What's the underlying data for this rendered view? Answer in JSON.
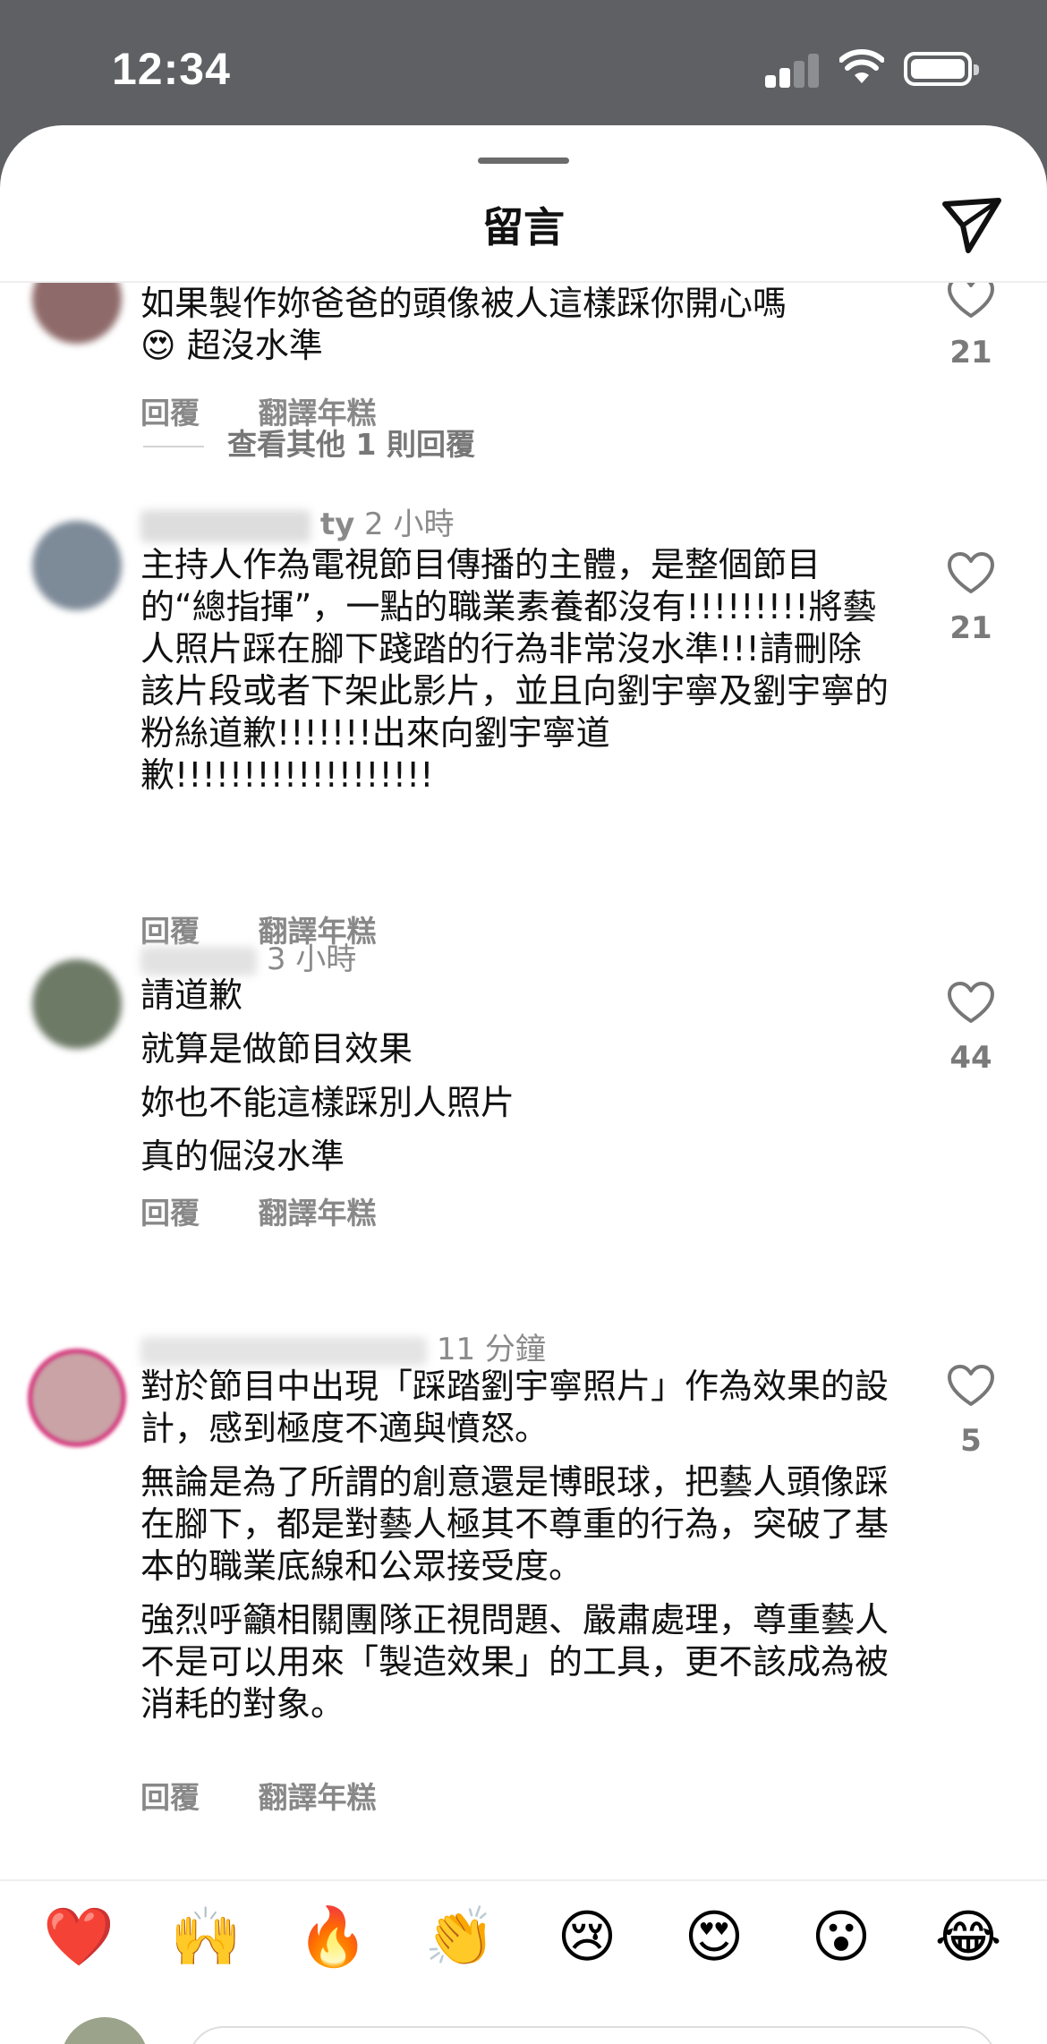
{
  "status_bar": {
    "time": "12:34"
  },
  "sheet": {
    "title": "留言"
  },
  "comments": [
    {
      "user": "",
      "time": "",
      "paragraphs": [
        "如果製作妳爸爸的頭像被人這樣踩你開心嗎\n😍 超沒水準"
      ],
      "likes": "21",
      "reply": "回覆",
      "translate": "翻譯年糕",
      "more_replies": "查看其他 1 則回覆"
    },
    {
      "user": "ty",
      "time": "2 小時",
      "paragraphs": [
        "主持人作為電視節目傳播的主體，是整個節目的“總指揮”，一點的職業素養都沒有!!!!!!!!!將藝人照片踩在腳下踐踏的行為非常沒水準!!!請刪除該片段或者下架此影片，並且向劉宇寧及劉宇寧的粉絲道歉!!!!!!!出來向劉宇寧道歉!!!!!!!!!!!!!!!!!!!"
      ],
      "likes": "21",
      "reply": "回覆",
      "translate": "翻譯年糕"
    },
    {
      "user": "",
      "time": "3 小時",
      "paragraphs": [
        "請道歉",
        "就算是做節目效果",
        "妳也不能這樣踩別人照片",
        "真的倔沒水準"
      ],
      "likes": "44",
      "reply": "回覆",
      "translate": "翻譯年糕"
    },
    {
      "user": "",
      "time": "11 分鐘",
      "paragraphs": [
        "對於節目中出現「踩踏劉宇寧照片」作為效果的設計，感到極度不適與憤怒。",
        "無論是為了所謂的創意還是博眼球，把藝人頭像踩在腳下，都是對藝人極其不尊重的行為，突破了基本的職業底線和公眾接受度。",
        "強烈呼籲相關團隊正視問題、嚴肅處理，尊重藝人不是可以用來「製造效果」的工具，更不該成為被消耗的對象。"
      ],
      "likes": "5",
      "reply": "回覆",
      "translate": "翻譯年糕"
    }
  ],
  "emoji_bar": [
    "❤️",
    "🙌",
    "🔥",
    "👏",
    "😢",
    "😍",
    "😮",
    "😂"
  ],
  "colors": {
    "sheet_bg": "#ffffff",
    "statusbar_bg": "#5f6063",
    "muted_text": "#8a8a8a"
  }
}
